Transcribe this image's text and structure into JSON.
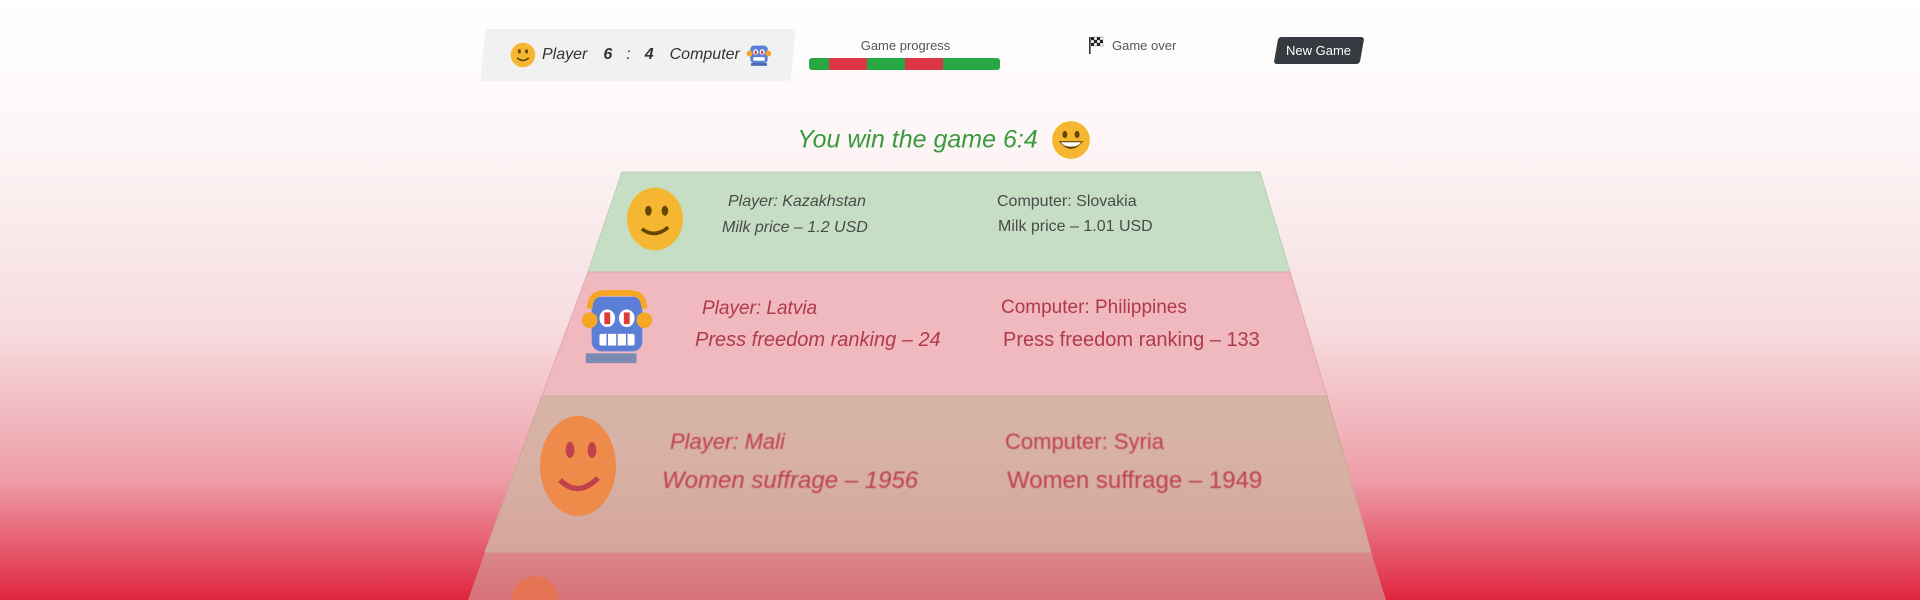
{
  "scoreboard": {
    "player_label": "Player",
    "player_score": "6",
    "separator": ":",
    "computer_score": "4",
    "computer_label": "Computer"
  },
  "progress": {
    "label": "Game progress",
    "segments": [
      "win",
      "loss",
      "win",
      "loss",
      "win"
    ]
  },
  "status": {
    "text": "Game over",
    "icon": "checkered-flag-icon"
  },
  "new_game_label": "New Game",
  "result_message": "You win the game 6:4",
  "rounds": [
    {
      "winner": "player",
      "player": "Player: Kazakhstan",
      "player_value": "Milk price – 1.2 USD",
      "computer": "Computer: Slovakia",
      "computer_value": "Milk price – 1.01 USD"
    },
    {
      "winner": "computer",
      "player": "Player: Latvia",
      "player_value": "Press freedom ranking – 24",
      "computer": "Computer: Philippines",
      "computer_value": "Press freedom ranking – 133"
    },
    {
      "winner": "player",
      "player": "Player: Mali",
      "player_value": "Women suffrage – 1956",
      "computer": "Computer: Syria",
      "computer_value": "Women suffrage – 1949"
    }
  ],
  "colors": {
    "win": "#28a745",
    "loss": "#dc3545",
    "row_win": "#c6dfc4",
    "row_loss": "#f0b8bf",
    "row_third": "#d2b3a2",
    "button": "#343a40"
  }
}
